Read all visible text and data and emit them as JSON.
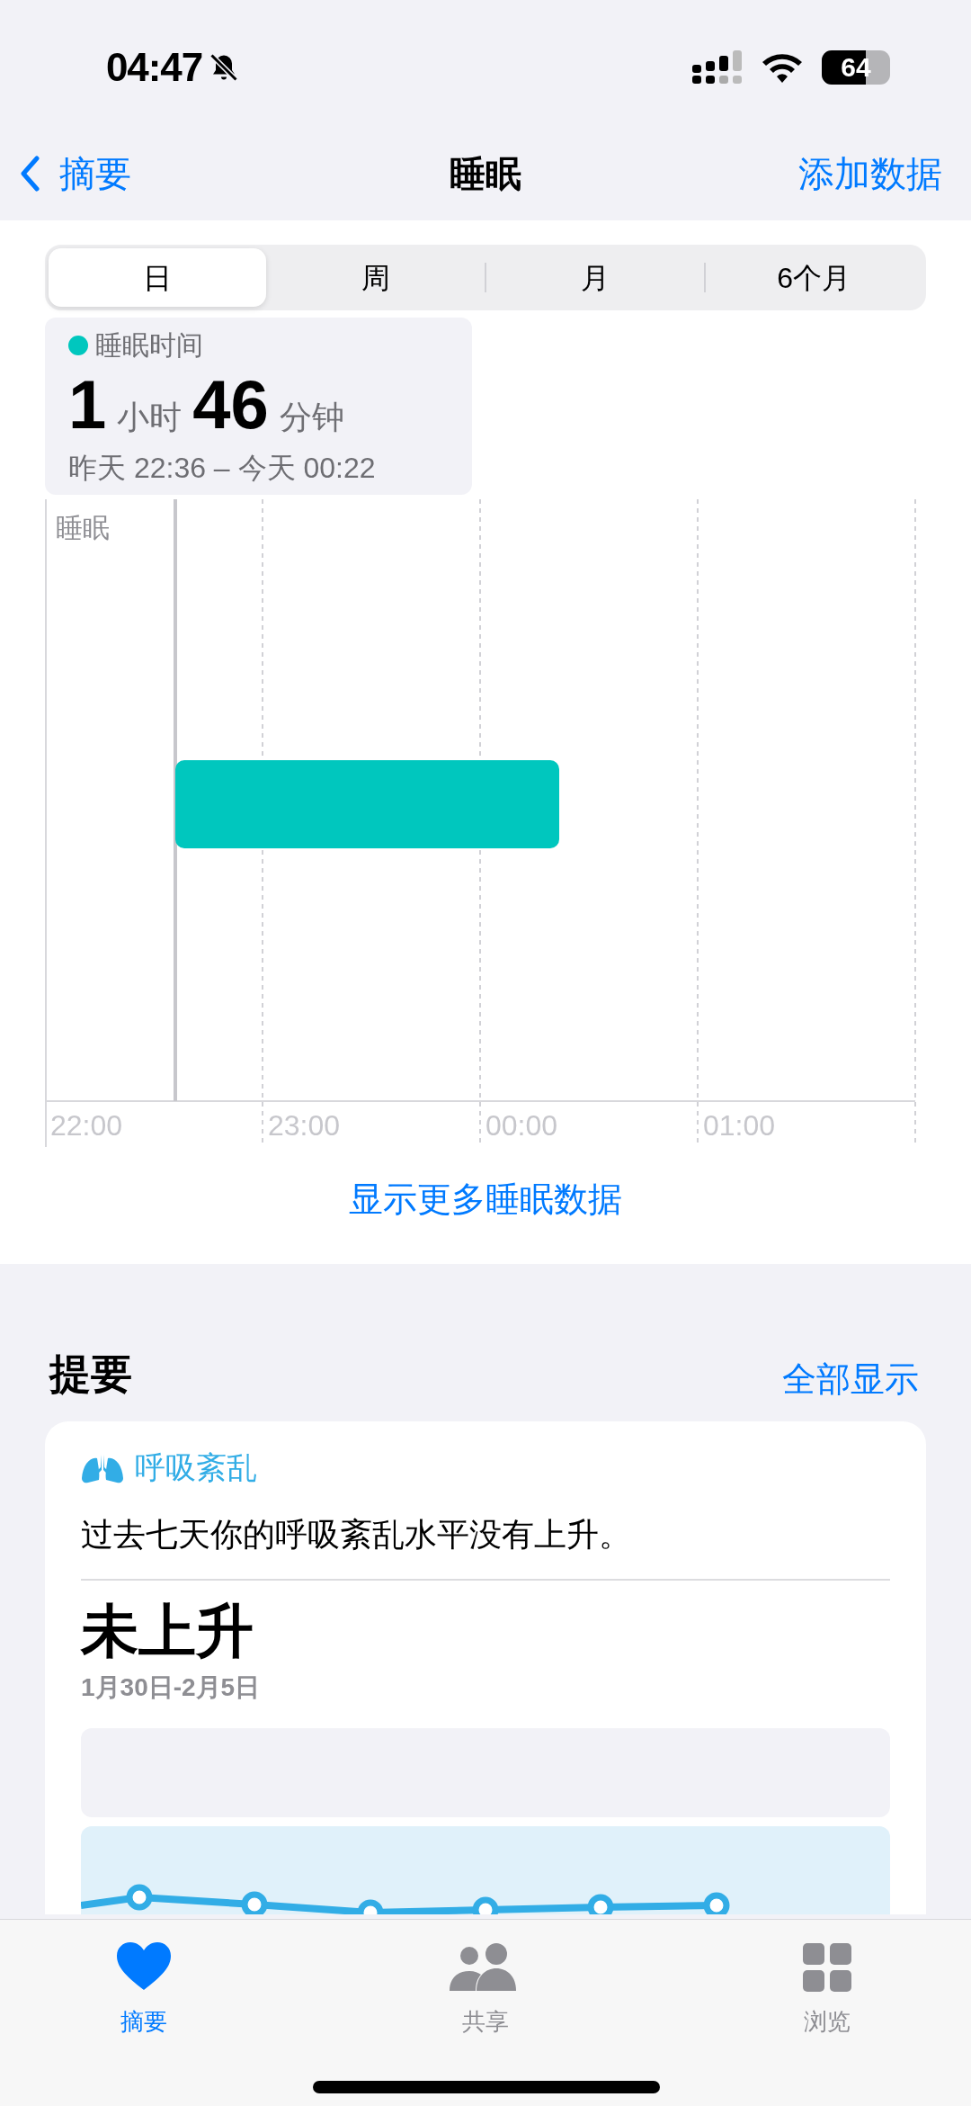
{
  "status_bar": {
    "time": "04:47",
    "silent": true,
    "battery": "64"
  },
  "nav": {
    "back": "摘要",
    "title": "睡眠",
    "action": "添加数据"
  },
  "segments": [
    {
      "label": "日",
      "selected": true
    },
    {
      "label": "周",
      "selected": false
    },
    {
      "label": "月",
      "selected": false
    },
    {
      "label": "6个月",
      "selected": false
    }
  ],
  "summary": {
    "legend": "睡眠时间",
    "hours": "1",
    "hours_unit": "小时",
    "minutes": "46",
    "minutes_unit": "分钟",
    "range": "昨天 22:36 – 今天 00:22"
  },
  "sleep_chart": {
    "row_label": "睡眠",
    "time_labels": [
      "22:00",
      "23:00",
      "00:00",
      "01:00"
    ]
  },
  "more_link": "显示更多睡眠数据",
  "highlights": {
    "title": "提要",
    "show_all": "全部显示",
    "card": {
      "category": "呼吸紊乱",
      "message": "过去七天你的呼吸紊乱水平没有上升。",
      "value": "未上升",
      "date_range": "1月30日-2月5日"
    }
  },
  "tab_bar": [
    {
      "label": "摘要",
      "kind": "heart",
      "selected": true
    },
    {
      "label": "共享",
      "kind": "people",
      "selected": false
    },
    {
      "label": "浏览",
      "kind": "grid",
      "selected": false
    }
  ]
}
